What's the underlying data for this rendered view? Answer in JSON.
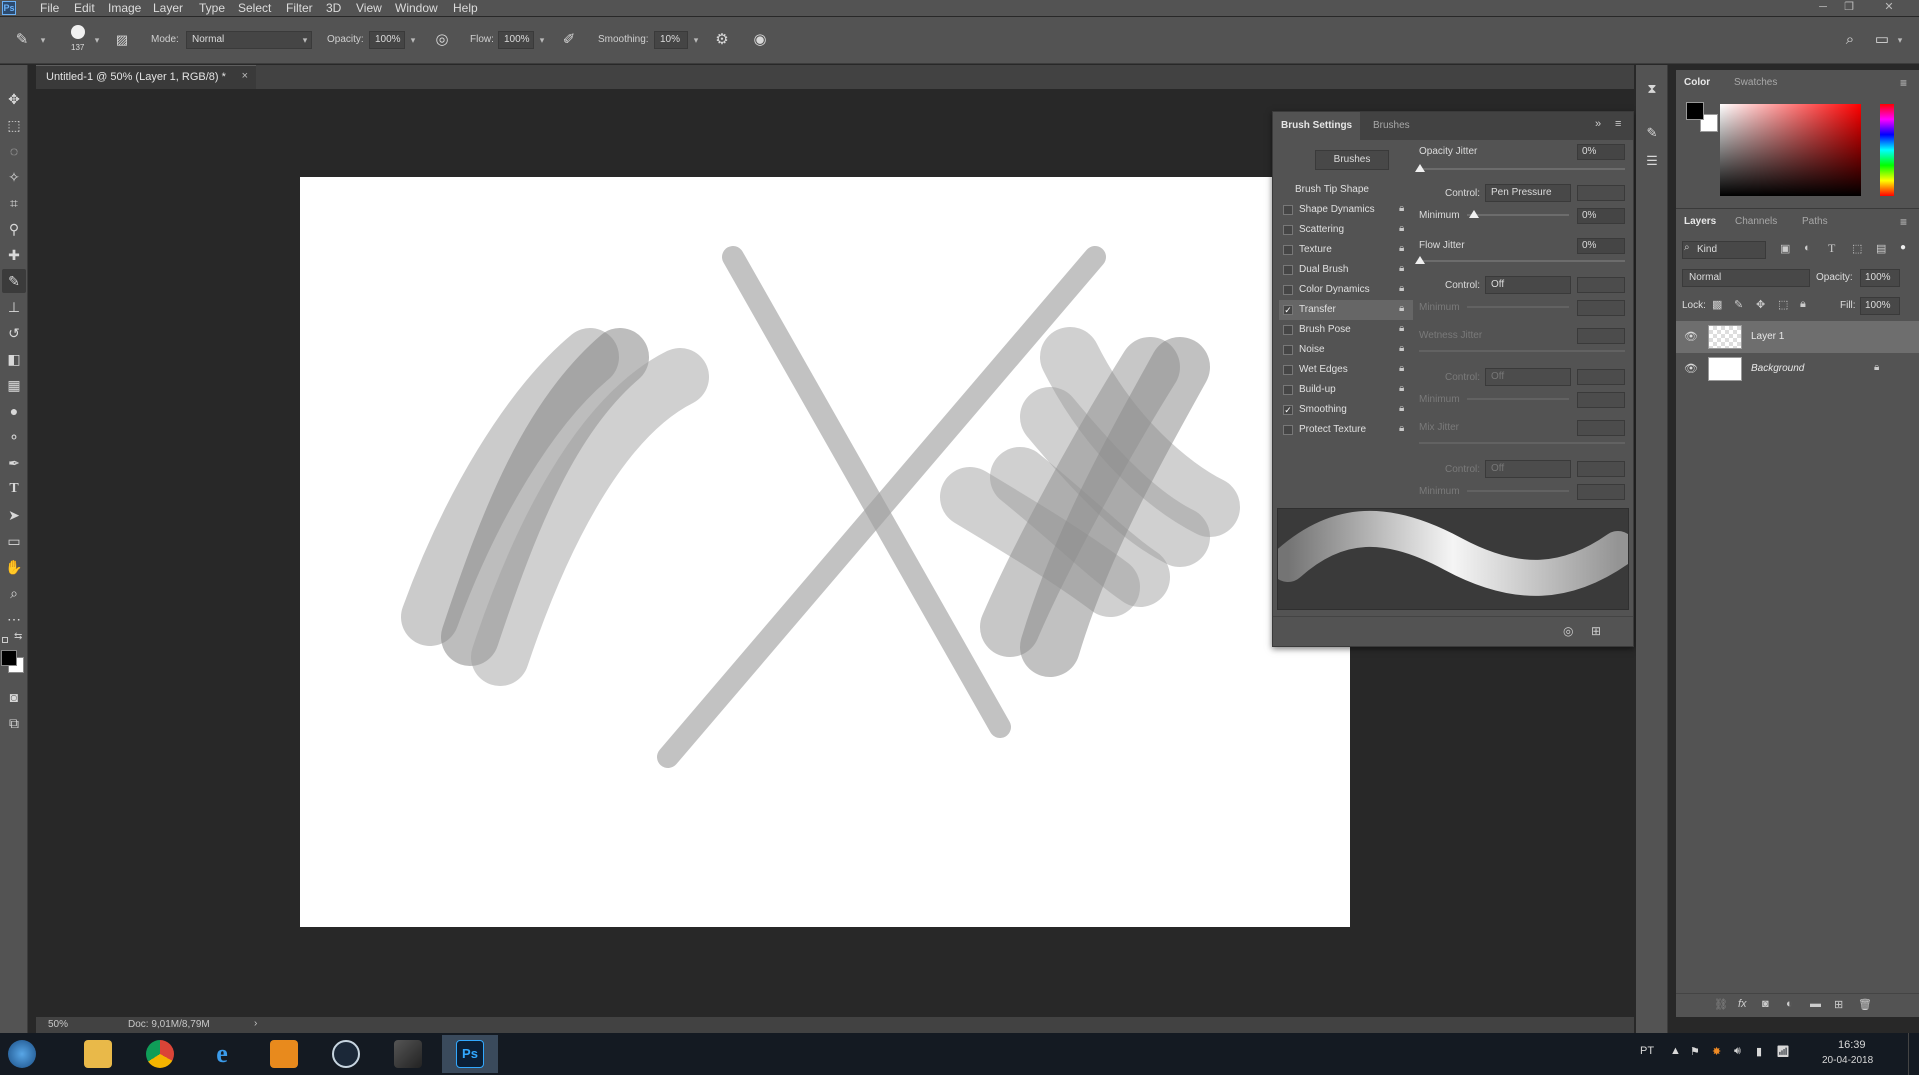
{
  "app": {
    "logo": "Ps"
  },
  "menu": [
    "File",
    "Edit",
    "Image",
    "Layer",
    "Type",
    "Select",
    "Filter",
    "3D",
    "View",
    "Window",
    "Help"
  ],
  "options": {
    "brush_size": "137",
    "mode_label": "Mode:",
    "mode_value": "Normal",
    "opacity_label": "Opacity:",
    "opacity_value": "100%",
    "flow_label": "Flow:",
    "flow_value": "100%",
    "smoothing_label": "Smoothing:",
    "smoothing_value": "10%"
  },
  "document": {
    "tab_title": "Untitled-1 @ 50% (Layer 1, RGB/8) *",
    "tab_close": "×"
  },
  "status": {
    "zoom": "50%",
    "doc": "Doc: 9,01M/8,79M",
    "arrow": "›"
  },
  "brush_panel": {
    "tabs": [
      "Brush Settings",
      "Brushes"
    ],
    "brushes_button": "Brushes",
    "items": [
      {
        "label": "Brush Tip Shape",
        "checkbox": false,
        "checked": false
      },
      {
        "label": "Shape Dynamics",
        "checkbox": true,
        "checked": false
      },
      {
        "label": "Scattering",
        "checkbox": true,
        "checked": false
      },
      {
        "label": "Texture",
        "checkbox": true,
        "checked": false
      },
      {
        "label": "Dual Brush",
        "checkbox": true,
        "checked": false
      },
      {
        "label": "Color Dynamics",
        "checkbox": true,
        "checked": false
      },
      {
        "label": "Transfer",
        "checkbox": true,
        "checked": true
      },
      {
        "label": "Brush Pose",
        "checkbox": true,
        "checked": false
      },
      {
        "label": "Noise",
        "checkbox": true,
        "checked": false
      },
      {
        "label": "Wet Edges",
        "checkbox": true,
        "checked": false
      },
      {
        "label": "Build-up",
        "checkbox": true,
        "checked": false
      },
      {
        "label": "Smoothing",
        "checkbox": true,
        "checked": true
      },
      {
        "label": "Protect Texture",
        "checkbox": true,
        "checked": false
      }
    ],
    "transfer": {
      "opacity_jitter_label": "Opacity Jitter",
      "opacity_jitter_value": "0%",
      "control_label": "Control:",
      "control_value_1": "Pen Pressure",
      "minimum_label": "Minimum",
      "minimum_value": "0%",
      "flow_jitter_label": "Flow Jitter",
      "flow_jitter_value": "0%",
      "control_value_2": "Off",
      "minimum_2_label": "Minimum",
      "wetness_jitter_label": "Wetness Jitter",
      "control_value_3": "Off",
      "minimum_3_label": "Minimum",
      "mix_jitter_label": "Mix Jitter",
      "control_value_4": "Off",
      "minimum_4_label": "Minimum"
    }
  },
  "color_panel": {
    "tabs": [
      "Color",
      "Swatches"
    ],
    "foreground": "#000000",
    "background": "#ffffff"
  },
  "layers_panel": {
    "tabs": [
      "Layers",
      "Channels",
      "Paths"
    ],
    "kind_label": "Kind",
    "blend_mode": "Normal",
    "opacity_label": "Opacity:",
    "opacity_value": "100%",
    "lock_label": "Lock:",
    "fill_label": "Fill:",
    "fill_value": "100%",
    "layers": [
      {
        "name": "Layer 1",
        "selected": true,
        "locked": false
      },
      {
        "name": "Background",
        "selected": false,
        "locked": true
      }
    ]
  },
  "taskbar": {
    "lang": "PT",
    "time": "16:39",
    "date": "20-04-2018",
    "apps": [
      "start",
      "explorer",
      "chrome",
      "internet-explorer",
      "media-player",
      "steam",
      "app",
      "photoshop"
    ]
  }
}
